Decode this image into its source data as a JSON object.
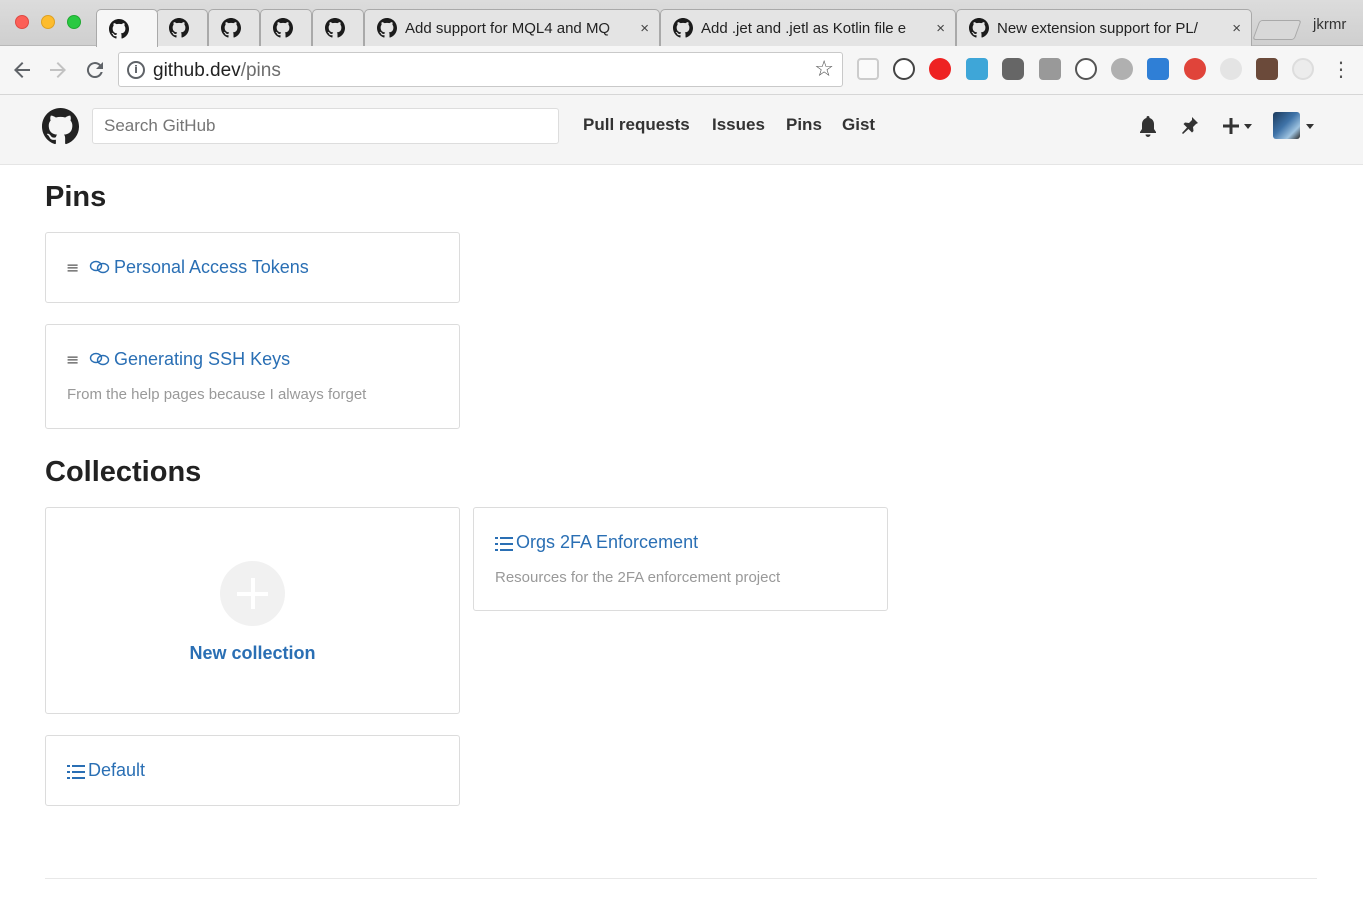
{
  "browser": {
    "tabs": [
      {
        "title": "",
        "active": true
      },
      {
        "title": ""
      },
      {
        "title": ""
      },
      {
        "title": ""
      },
      {
        "title": ""
      },
      {
        "title": "Add support for MQL4 and MQ"
      },
      {
        "title": "Add .jet and .jetl as Kotlin file e"
      },
      {
        "title": "New extension support for PL/"
      }
    ],
    "tab_close": "×",
    "profile_name": "jkrmr",
    "url_host": "github.dev",
    "url_path": "/pins"
  },
  "header": {
    "search_placeholder": "Search GitHub",
    "nav": [
      "Pull requests",
      "Issues",
      "Pins",
      "Gist"
    ]
  },
  "pins": {
    "title": "Pins",
    "items": [
      {
        "label": "Personal Access Tokens",
        "description": ""
      },
      {
        "label": "Generating SSH Keys",
        "description": "From the help pages because I always forget"
      }
    ]
  },
  "collections": {
    "title": "Collections",
    "new_label": "New collection",
    "items": [
      {
        "label": "Orgs 2FA Enforcement",
        "description": "Resources for the 2FA enforcement project"
      },
      {
        "label": "Default",
        "description": ""
      }
    ]
  },
  "colors": {
    "link": "#2a6fb4",
    "muted": "#999999",
    "header_bg": "#f5f5f5"
  }
}
